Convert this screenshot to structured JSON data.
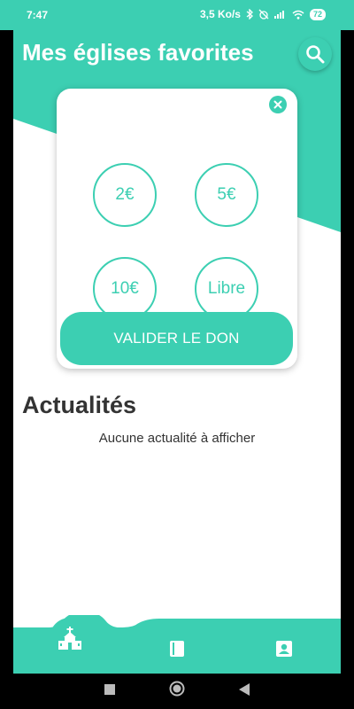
{
  "status_bar": {
    "time": "7:47",
    "network_speed": "3,5 Ko/s",
    "battery": "72"
  },
  "app": {
    "title": "Mes églises favorites",
    "accent_color": "#3ccfb2"
  },
  "donation": {
    "amounts": [
      "2€",
      "5€",
      "10€",
      "Libre"
    ],
    "validate_label": "VALIDER LE DON"
  },
  "news": {
    "title": "Actualités",
    "empty_message": "Aucune actualité à afficher"
  },
  "bottom_nav": {
    "items": [
      {
        "icon": "church-icon",
        "active": true
      },
      {
        "icon": "book-icon",
        "active": false
      },
      {
        "icon": "contact-icon",
        "active": false
      }
    ]
  },
  "system_nav": {
    "buttons": [
      "recent-apps-icon",
      "home-icon",
      "back-icon"
    ]
  }
}
